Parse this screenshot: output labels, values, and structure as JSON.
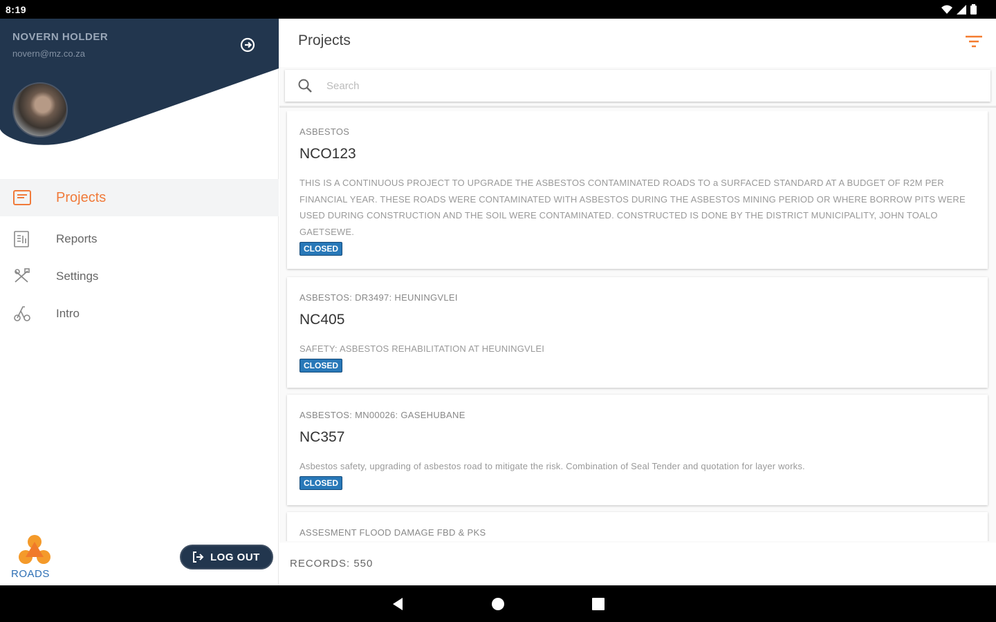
{
  "status_bar": {
    "time": "8:19"
  },
  "user": {
    "name": "NOVERN HOLDER",
    "email": "novern@mz.co.za"
  },
  "nav": {
    "items": [
      {
        "label": "Projects",
        "icon": "projects-icon",
        "active": true
      },
      {
        "label": "Reports",
        "icon": "reports-icon",
        "active": false
      },
      {
        "label": "Settings",
        "icon": "settings-icon",
        "active": false
      },
      {
        "label": "Intro",
        "icon": "intro-icon",
        "active": false
      }
    ]
  },
  "brand": {
    "logo_text": "ROADS"
  },
  "logout": {
    "label": "LOG OUT"
  },
  "header": {
    "title": "Projects"
  },
  "search": {
    "placeholder": "Search"
  },
  "projects": [
    {
      "category": "ASBESTOS",
      "code": "NCO123",
      "description": "THIS IS A CONTINUOUS PROJECT TO UPGRADE THE ASBESTOS CONTAMINATED ROADS TO a SURFACED STANDARD AT A BUDGET OF R2M PER FINANCIAL YEAR. THESE ROADS WERE CONTAMINATED WITH ASBESTOS DURING THE ASBESTOS MINING PERIOD OR WHERE BORROW PITS WERE USED DURING CONSTRUCTION AND THE SOIL WERE CONTAMINATED. CONSTRUCTED IS DONE BY THE DISTRICT MUNICIPALITY, JOHN TOALO GAETSEWE.",
      "status": "CLOSED"
    },
    {
      "category": "ASBESTOS: DR3497: HEUNINGVLEI",
      "code": "NC405",
      "description": "SAFETY: ASBESTOS REHABILITATION AT HEUNINGVLEI",
      "status": "CLOSED"
    },
    {
      "category": "ASBESTOS: MN00026: GASEHUBANE",
      "code": "NC357",
      "description": "Asbestos safety, upgrading of asbestos road to mitigate the risk. Combination of Seal Tender and quotation for layer works.",
      "status": "CLOSED"
    },
    {
      "category": "ASSESMENT FLOOD DAMAGE FBD & PKS",
      "code": "",
      "description": "",
      "status": ""
    }
  ],
  "footer": {
    "records": "RECORDS: 550"
  },
  "colors": {
    "accent": "#f47b2f",
    "header_bg": "#22364e",
    "badge": "#2878b8"
  }
}
